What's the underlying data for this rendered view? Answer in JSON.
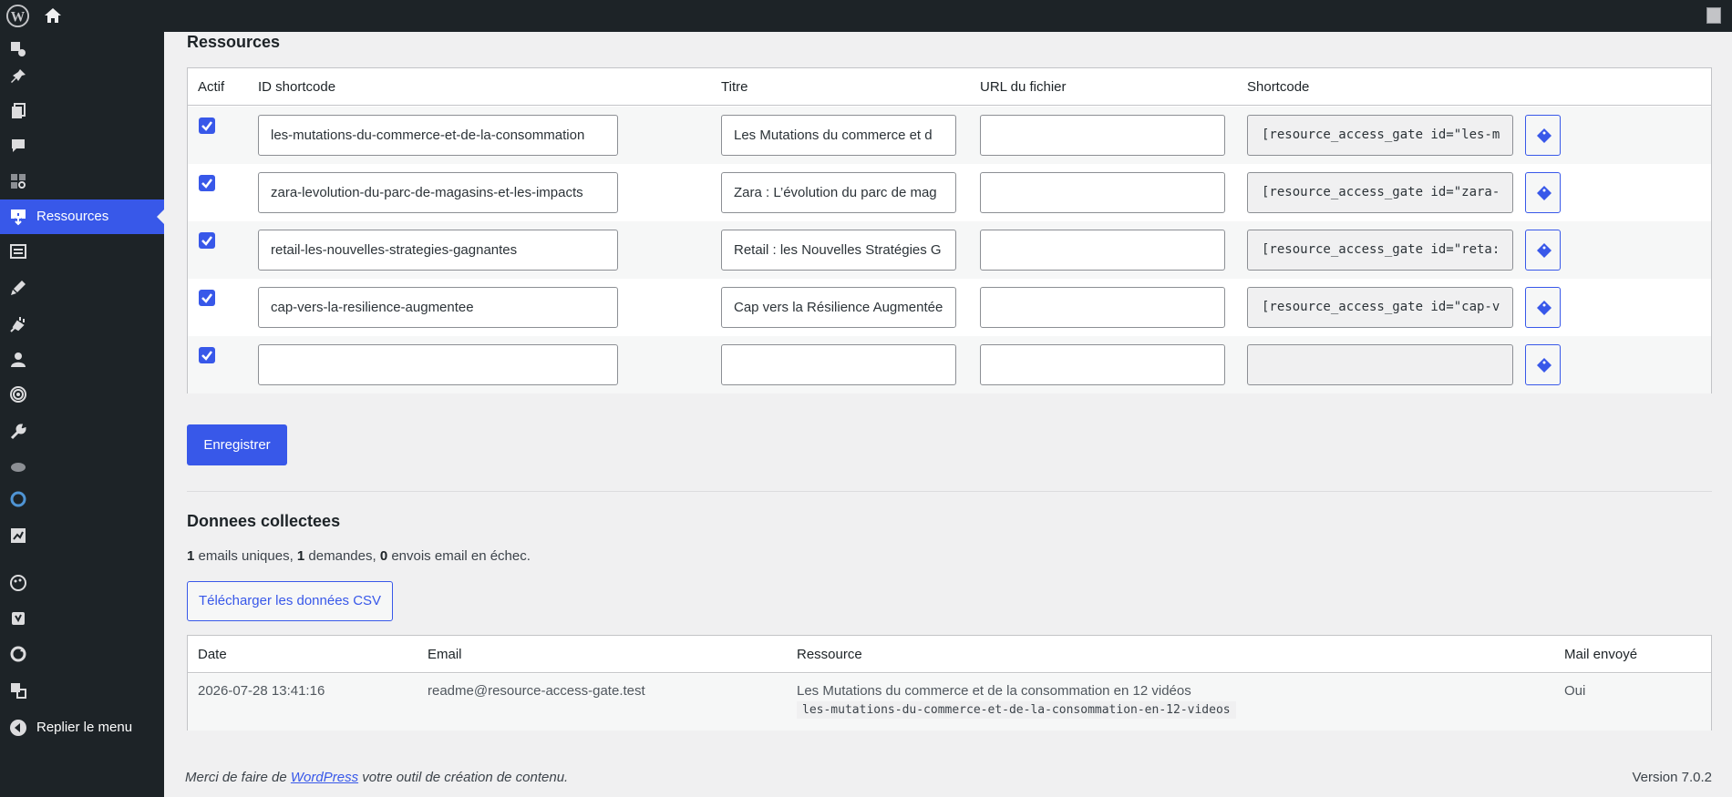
{
  "admin_bar": {
    "site_icon": "wordpress-logo-icon",
    "home_icon": "home-icon"
  },
  "sidebar": {
    "items": [
      {
        "icon": "media-icon",
        "label": ""
      },
      {
        "icon": "pin-icon",
        "label": ""
      },
      {
        "icon": "pages-icon",
        "label": ""
      },
      {
        "icon": "comments-icon",
        "label": ""
      },
      {
        "icon": "blocks-icon",
        "label": ""
      },
      {
        "icon": "download-icon",
        "label": "Ressources",
        "active": true
      },
      {
        "icon": "forms-icon",
        "label": ""
      },
      {
        "icon": "appearance-icon",
        "label": ""
      },
      {
        "icon": "plugins-icon",
        "label": ""
      },
      {
        "icon": "users-icon",
        "label": ""
      },
      {
        "icon": "fingerprint-icon",
        "label": ""
      },
      {
        "icon": "tools-icon",
        "label": ""
      },
      {
        "icon": "cloud-icon",
        "label": ""
      },
      {
        "icon": "circle-icon",
        "label": ""
      },
      {
        "icon": "chart-icon",
        "label": ""
      },
      {
        "icon": "palette-icon",
        "label": ""
      },
      {
        "icon": "yoast-icon",
        "label": ""
      },
      {
        "icon": "sync-icon",
        "label": ""
      },
      {
        "icon": "translate-icon",
        "label": ""
      }
    ],
    "collapse_label": "Replier le menu"
  },
  "resources": {
    "title": "Ressources",
    "columns": [
      "Actif",
      "ID shortcode",
      "Titre",
      "URL du fichier",
      "Shortcode"
    ],
    "rows": [
      {
        "active": true,
        "id": "les-mutations-du-commerce-et-de-la-consommation",
        "title": "Les Mutations du commerce et d",
        "url": "",
        "shortcode": "[resource_access_gate id=\"les-m"
      },
      {
        "active": true,
        "id": "zara-levolution-du-parc-de-magasins-et-les-impacts",
        "title": "Zara : L’évolution du parc de mag",
        "url": "",
        "shortcode": "[resource_access_gate id=\"zara-"
      },
      {
        "active": true,
        "id": "retail-les-nouvelles-strategies-gagnantes",
        "title": "Retail : les Nouvelles Stratégies G",
        "url": "",
        "shortcode": "[resource_access_gate id=\"reta:"
      },
      {
        "active": true,
        "id": "cap-vers-la-resilience-augmentee",
        "title": "Cap vers la Résilience Augmentée",
        "url": "",
        "shortcode": "[resource_access_gate id=\"cap-v"
      },
      {
        "active": true,
        "id": "",
        "title": "",
        "url": "",
        "shortcode": ""
      }
    ],
    "save_label": "Enregistrer"
  },
  "collected": {
    "title": "Donnees collectees",
    "emails_count": "1",
    "emails_label": " emails uniques, ",
    "requests_count": "1",
    "requests_label": " demandes, ",
    "failed_count": "0",
    "failed_label": " envois email en échec.",
    "download_label": "Télécharger les données CSV",
    "columns": [
      "Date",
      "Email",
      "Ressource",
      "Mail envoyé"
    ],
    "rows": [
      {
        "date": "2026-07-28 13:41:16",
        "email": "readme@resource-access-gate.test",
        "resource_title": "Les Mutations du commerce et de la consommation en 12 vidéos",
        "resource_id": "les-mutations-du-commerce-et-de-la-consommation-en-12-videos",
        "sent": "Oui"
      }
    ]
  },
  "footer": {
    "thanks_before": "Merci de faire de ",
    "thanks_link": "WordPress",
    "thanks_after": " votre outil de création de contenu.",
    "version": "Version 7.0.2"
  },
  "colors": {
    "accent": "#3858e9",
    "sidebar_bg": "#1d2327",
    "page_bg": "#f0f0f1"
  }
}
